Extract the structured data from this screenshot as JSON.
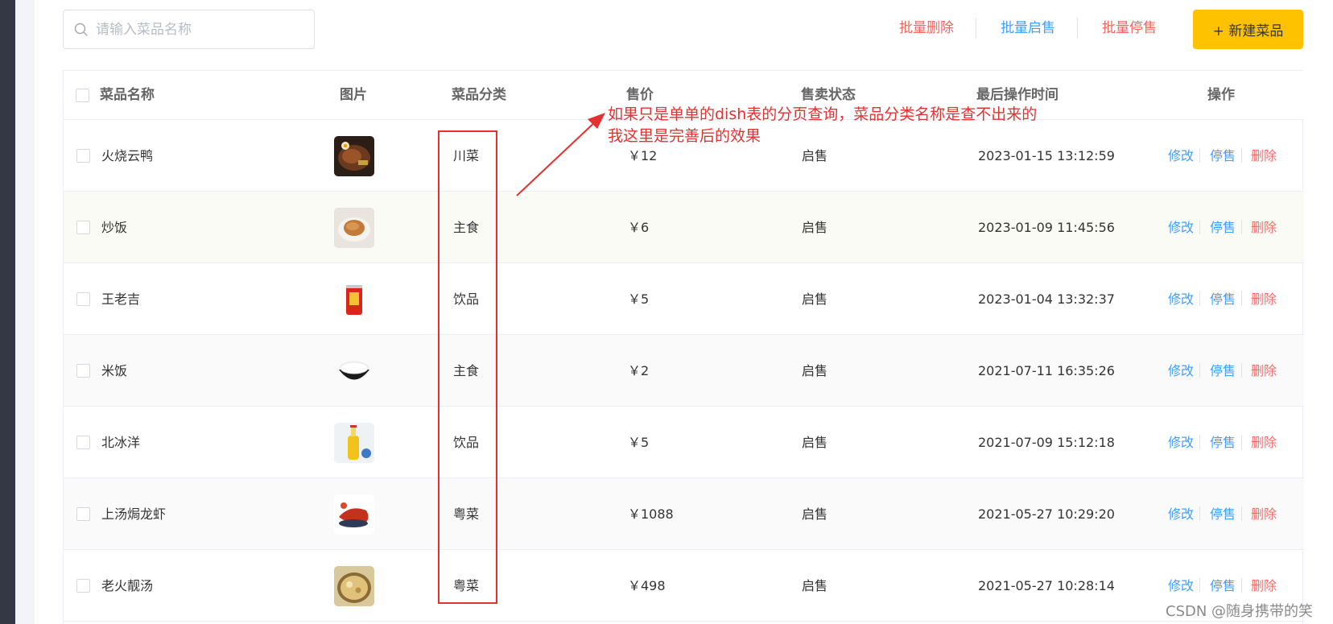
{
  "search": {
    "placeholder": "请输入菜品名称"
  },
  "toolbar": {
    "batch_delete_label": "批量删除",
    "batch_enable_label": "批量启售",
    "batch_disable_label": "批量停售",
    "add_dish_label": "+ 新建菜品"
  },
  "table": {
    "headers": {
      "name": "菜品名称",
      "image": "图片",
      "category": "菜品分类",
      "price": "售价",
      "status": "售卖状态",
      "updated": "最后操作时间",
      "actions": "操作"
    },
    "rows": [
      {
        "name": "火烧云鸭",
        "image_icon": "roast-duck-thumbnail",
        "category": "川菜",
        "price": "￥12",
        "status": "启售",
        "updated": "2023-01-15 13:12:59",
        "edit": "修改",
        "toggle": "停售",
        "delete": "删除"
      },
      {
        "name": "炒饭",
        "image_icon": "fried-rice-thumbnail",
        "category": "主食",
        "price": "￥6",
        "status": "启售",
        "updated": "2023-01-09 11:45:56",
        "edit": "修改",
        "toggle": "停售",
        "delete": "删除"
      },
      {
        "name": "王老吉",
        "image_icon": "red-can-drink-thumbnail",
        "category": "饮品",
        "price": "￥5",
        "status": "启售",
        "updated": "2023-01-04 13:32:37",
        "edit": "修改",
        "toggle": "停售",
        "delete": "删除"
      },
      {
        "name": "米饭",
        "image_icon": "rice-bowl-thumbnail",
        "category": "主食",
        "price": "￥2",
        "status": "启售",
        "updated": "2021-07-11 16:35:26",
        "edit": "修改",
        "toggle": "停售",
        "delete": "删除"
      },
      {
        "name": "北冰洋",
        "image_icon": "soda-bottle-thumbnail",
        "category": "饮品",
        "price": "￥5",
        "status": "启售",
        "updated": "2021-07-09 15:12:18",
        "edit": "修改",
        "toggle": "停售",
        "delete": "删除"
      },
      {
        "name": "上汤焗龙虾",
        "image_icon": "lobster-thumbnail",
        "category": "粤菜",
        "price": "￥1088",
        "status": "启售",
        "updated": "2021-05-27 10:29:20",
        "edit": "修改",
        "toggle": "停售",
        "delete": "删除"
      },
      {
        "name": "老火靓汤",
        "image_icon": "soup-thumbnail",
        "category": "粤菜",
        "price": "￥498",
        "status": "启售",
        "updated": "2021-05-27 10:28:14",
        "edit": "修改",
        "toggle": "停售",
        "delete": "删除"
      }
    ]
  },
  "annotation": {
    "line1": "如果只是单单的dish表的分页查询，菜品分类名称是查不出来的",
    "line2": "我这里是完善后的效果"
  },
  "watermark": "CSDN @随身携带的笑",
  "colors": {
    "accent_yellow": "#ffc200",
    "link_blue": "#409eff",
    "link_red": "#f56c6c",
    "annotation_red": "#e53030"
  }
}
